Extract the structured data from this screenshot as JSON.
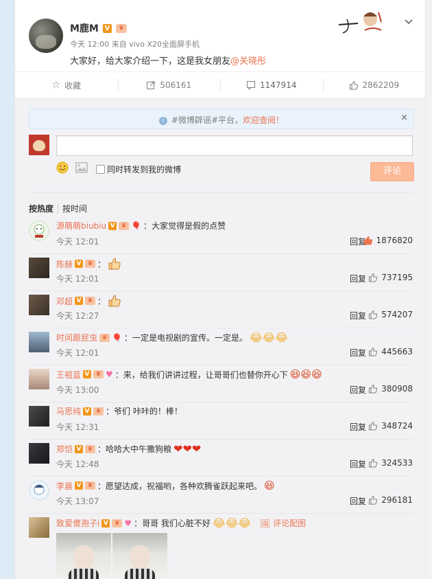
{
  "post": {
    "author": "M鹿M",
    "level_badge": "V",
    "meta": "今天 12:00 来自 vivo X20全面屏手机",
    "text_prefix": "大家好，给大家介绍一下，这是我女朋友",
    "mention": "@关晓彤"
  },
  "actions": {
    "favorite": "收藏",
    "repost": "506161",
    "comment": "1147914",
    "like": "2862209"
  },
  "notice": {
    "prefix": "#微博辟谣#平台，",
    "link": "欢迎查阅！",
    "close": "×"
  },
  "composer": {
    "forward_label": "同时转发到我的微博",
    "submit": "评论"
  },
  "sort": {
    "hot": "按热度",
    "time": "按时间"
  },
  "comments": [
    {
      "name": "源萌萌biubiu",
      "text": "：大家觉得是假的点赞",
      "time": "今天 12:01",
      "reply": "回复",
      "likes": "1876820",
      "hot": true
    },
    {
      "name": "陈赫",
      "text": "：",
      "time": "今天 12:01",
      "reply": "回复",
      "likes": "737195"
    },
    {
      "name": "邓超",
      "text": "：",
      "time": "今天 12:27",
      "reply": "回复",
      "likes": "574207"
    },
    {
      "name": "时间跟屁虫",
      "text": "：一定是电视剧的宣传。一定是。",
      "time": "今天 12:01",
      "reply": "回复",
      "likes": "445663"
    },
    {
      "name": "王祖蓝",
      "text": "：来，给我们讲讲过程，让哥哥们也替你开心下",
      "time": "今天 13:00",
      "reply": "回复",
      "likes": "380908"
    },
    {
      "name": "马思纯",
      "text": "：爷们 咔咔的！棒！",
      "time": "今天 12:31",
      "reply": "回复",
      "likes": "348724"
    },
    {
      "name": "郑恺",
      "text": "：哈哈大中午撒狗粮",
      "time": "今天 12:48",
      "reply": "回复",
      "likes": "324533"
    },
    {
      "name": "李晨",
      "text": "：愿望达成，祝福哟，各种欢腾雀跃起来吧。",
      "time": "今天 13:07",
      "reply": "回复",
      "likes": "296181"
    },
    {
      "name": "致爱傻孢子i",
      "text": "：哥哥 我们心脏不好",
      "pic_link": "评论配图"
    }
  ],
  "colors": {
    "accent": "#eb7350",
    "verified": "#f29618",
    "submit": "#fbb996",
    "background": "#dcebf5"
  }
}
